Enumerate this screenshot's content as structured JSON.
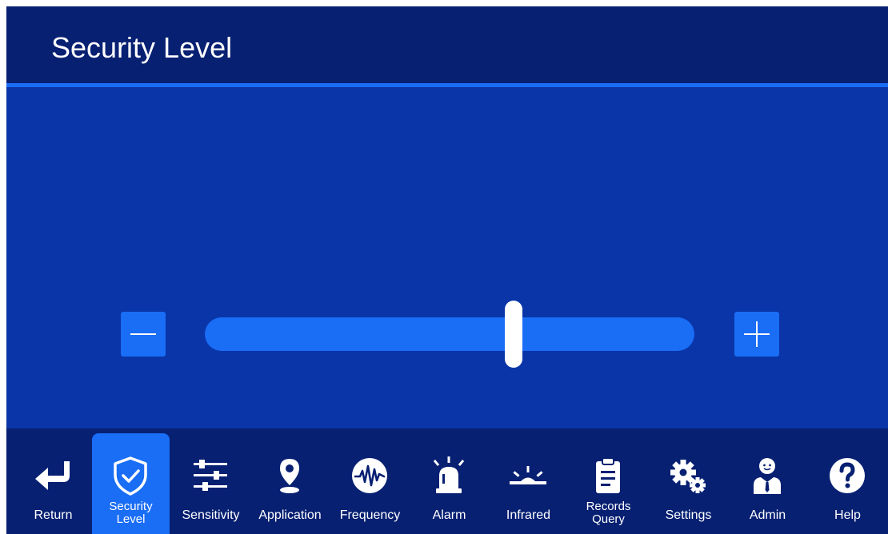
{
  "header": {
    "title": "Security Level"
  },
  "slider": {
    "value_fraction": 0.64
  },
  "colors": {
    "background": "#0a35a8",
    "header": "#072072",
    "accent": "#1a6df5",
    "text": "#ffffff"
  },
  "nav": {
    "active": "Security Level",
    "items": [
      {
        "label": "Return",
        "icon": "return-arrow-icon"
      },
      {
        "label": "Security Level",
        "icon": "shield-check-icon"
      },
      {
        "label": "Sensitivity",
        "icon": "sliders-icon"
      },
      {
        "label": "Application",
        "icon": "map-pin-icon"
      },
      {
        "label": "Frequency",
        "icon": "waveform-icon"
      },
      {
        "label": "Alarm",
        "icon": "alarm-siren-icon"
      },
      {
        "label": "Infrared",
        "icon": "infrared-icon"
      },
      {
        "label": "Records Query",
        "icon": "clipboard-icon"
      },
      {
        "label": "Settings",
        "icon": "gears-icon"
      },
      {
        "label": "Admin",
        "icon": "admin-user-icon"
      },
      {
        "label": "Help",
        "icon": "help-question-icon"
      }
    ]
  }
}
